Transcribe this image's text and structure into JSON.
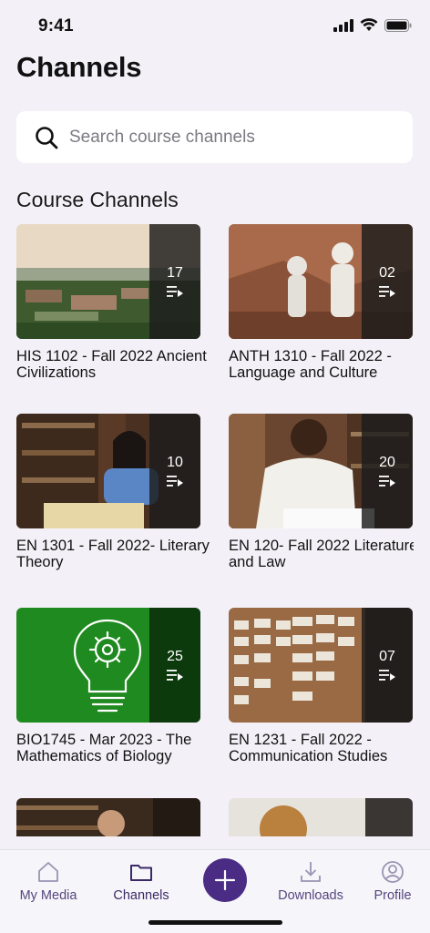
{
  "status": {
    "time": "9:41"
  },
  "page": {
    "title": "Channels"
  },
  "search": {
    "placeholder": "Search course channels",
    "value": ""
  },
  "section": {
    "heading": "Course Channels"
  },
  "channels": [
    {
      "title_line1": "HIS 1102 - Fall 2022 Ancient",
      "title_line2": "Civilizations",
      "count": "17"
    },
    {
      "title_line1": "ANTH 1310 - Fall 2022 -",
      "title_line2": "Language and Culture",
      "count": "02"
    },
    {
      "title_line1": "EN 1301 - Fall 2022- Literary",
      "title_line2": "Theory",
      "count": "10"
    },
    {
      "title_line1": "EN 120- Fall 2022 Literature",
      "title_line2": "and Law",
      "count": "20"
    },
    {
      "title_line1": "BIO1745 - Mar 2023 - The",
      "title_line2": "Mathematics of Biology",
      "count": "25"
    },
    {
      "title_line1": "EN 1231 - Fall 2022 -",
      "title_line2": "Communication Studies",
      "count": "07"
    }
  ],
  "nav": {
    "my_media": "My Media",
    "channels": "Channels",
    "downloads": "Downloads",
    "profile": "Profile"
  },
  "colors": {
    "accent": "#4a2c84",
    "nav_text": "#56477f",
    "background": "#f3f1f7",
    "bio_tile_green": "#1f8a1f"
  },
  "icons": [
    "signal-icon",
    "wifi-icon",
    "battery-icon",
    "search-icon",
    "playlist-icon",
    "home-icon",
    "folder-icon",
    "plus-icon",
    "download-icon",
    "profile-icon"
  ]
}
